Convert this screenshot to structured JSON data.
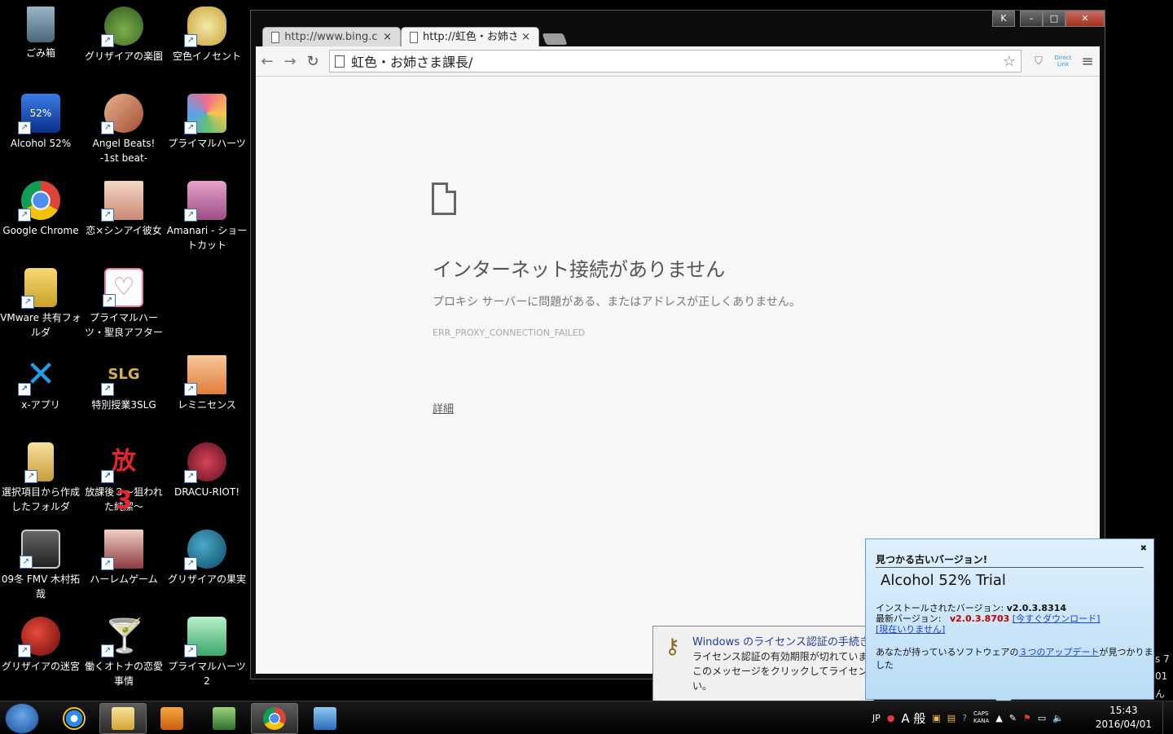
{
  "desktop": {
    "icons": [
      {
        "label": "ごみ箱"
      },
      {
        "label": "グリザイアの楽園"
      },
      {
        "label": "空色イノセント"
      },
      {
        "label": "Alcohol 52%"
      },
      {
        "label": "Angel Beats! -1st beat-"
      },
      {
        "label": "プライマルハーツ"
      },
      {
        "label": "Google Chrome"
      },
      {
        "label": "恋×シンアイ彼女"
      },
      {
        "label": "Amanari - ショートカット"
      },
      {
        "label": "VMware 共有フォルダ"
      },
      {
        "label": "プライマルハーツ・聖良アフター"
      },
      {
        "label": "x-アプリ"
      },
      {
        "label": "特別授業3SLG"
      },
      {
        "label": "レミニセンス"
      },
      {
        "label": "選択項目から作成したフォルダ"
      },
      {
        "label": "放課後３～狙われた純潔～"
      },
      {
        "label": "DRACU-RIOT!"
      },
      {
        "label": "09冬 FMV 木村拓哉"
      },
      {
        "label": "ハーレムゲーム"
      },
      {
        "label": "グリザイアの果実"
      },
      {
        "label": "グリザイアの迷宮"
      },
      {
        "label": "働くオトナの恋愛事情"
      },
      {
        "label": "プライマルハーツ2"
      }
    ]
  },
  "browser": {
    "tabs": [
      {
        "title": "http://www.bing.com/"
      },
      {
        "title": "http://虹色・お姉さま課"
      }
    ],
    "address": "虹色・お姉さま課長/",
    "toolbar_ext": "Direct Link",
    "error": {
      "title": "インターネット接続がありません",
      "subtitle": "プロキシ サーバーに問題がある、またはアドレスが正しくありません。",
      "code": "ERR_PROXY_CONNECTION_FAILED",
      "details_link": "詳細"
    }
  },
  "license_notice": {
    "title": "Windows のライセンス認証の手続き",
    "body_line1": "ライセンス認証の有効期限が切れていま",
    "body_line2": "このメッセージをクリックしてライセン",
    "body_line3": "い。"
  },
  "alcohol_popup": {
    "header": "見つかる古いバージョン!",
    "product": "Alcohol 52% Trial",
    "installed_label": "インストールされたバージョン:",
    "installed_version": "v2.0.3.8314",
    "latest_label": "最新バージョン:",
    "latest_version": "v2.0.3.8703",
    "download_link": "[今すぐダウンロード]",
    "not_now_link": "[現在いりません]",
    "message_prefix": "あなたが持っているソフトウェアの",
    "message_link": "３つのアップデート",
    "message_suffix": "が見つかりました"
  },
  "taskbar": {
    "apps": [
      {
        "name": "internet-explorer"
      },
      {
        "name": "file-explorer"
      },
      {
        "name": "media-player"
      },
      {
        "name": "system-app"
      },
      {
        "name": "google-chrome"
      },
      {
        "name": "network-app"
      }
    ],
    "tray": {
      "lang": "JP",
      "ime_mode": "A 般",
      "caps": "CAPS",
      "kana": "KANA"
    },
    "clock": {
      "time": "15:43",
      "date": "2016/04/01"
    }
  },
  "edge_text": {
    "line1": "s 7",
    "line2": "01",
    "line3": "ん"
  }
}
